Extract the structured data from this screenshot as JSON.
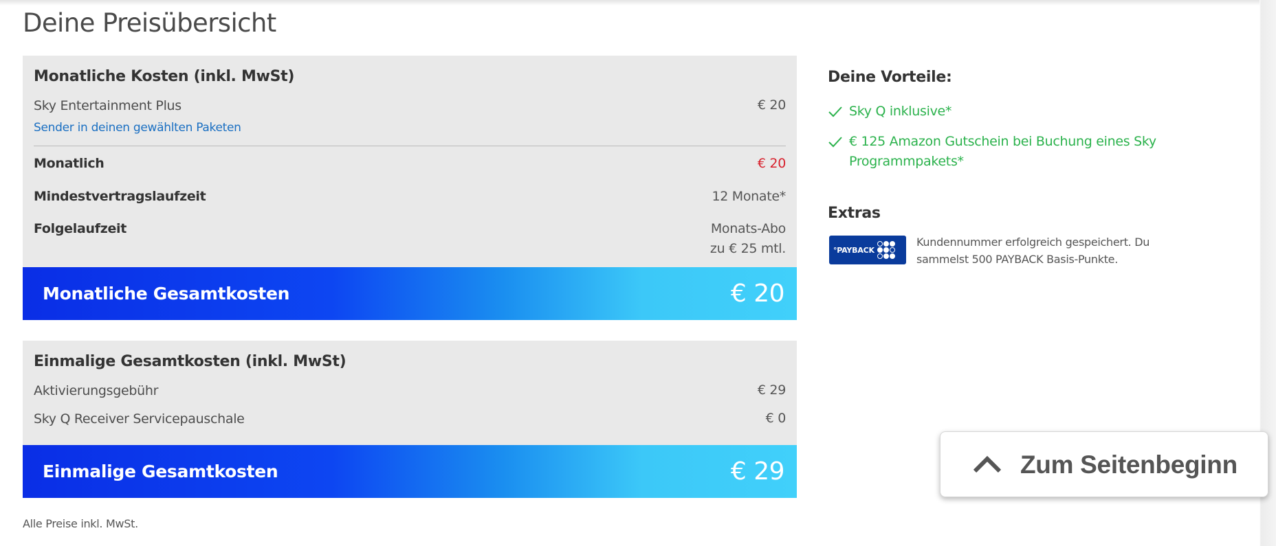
{
  "page": {
    "title": "Deine Preisübersicht",
    "footnote": "Alle Preise inkl. MwSt."
  },
  "monthly": {
    "heading": "Monatliche Kosten (inkl. MwSt)",
    "item_label": "Sky Entertainment Plus",
    "item_value": "€ 20",
    "item_link": "Sender in deinen gewählten Paketen",
    "rows": [
      {
        "label": "Monatlich",
        "value": "€ 20"
      },
      {
        "label": "Mindestvertragslaufzeit",
        "value": "12 Monate*"
      },
      {
        "label": "Folgelaufzeit",
        "value_line1": "Monats-Abo",
        "value_line2": "zu € 25 mtl."
      }
    ],
    "total_label": "Monatliche Gesamtkosten",
    "total_value": "€ 20"
  },
  "once": {
    "heading": "Einmalige Gesamtkosten (inkl. MwSt)",
    "rows": [
      {
        "label": "Aktivierungsgebühr",
        "value": "€ 29"
      },
      {
        "label": "Sky Q Receiver Servicepauschale",
        "value": "€ 0"
      }
    ],
    "total_label": "Einmalige Gesamtkosten",
    "total_value": "€ 29"
  },
  "benefits": {
    "heading": "Deine Vorteile:",
    "items": [
      "Sky Q inklusive*",
      "€ 125 Amazon Gutschein bei Buchung eines Sky Programmpakets*"
    ],
    "icon": "check-icon"
  },
  "extras": {
    "heading": "Extras",
    "logo_text": "°PAYBACK",
    "text": "Kundennummer erfolgreich gespeichert. Du sammelst 500 PAYBACK Basis-Punkte."
  },
  "scroll_top": {
    "label": "Zum Seitenbeginn",
    "icon": "chevron-up-icon"
  },
  "colors": {
    "accent_green": "#2bb24c",
    "price_red": "#d8202c",
    "link_blue": "#1a6fc2",
    "bar_start": "#0a2ee6",
    "bar_end": "#41d0fa",
    "payback_blue": "#0a3b9c"
  }
}
